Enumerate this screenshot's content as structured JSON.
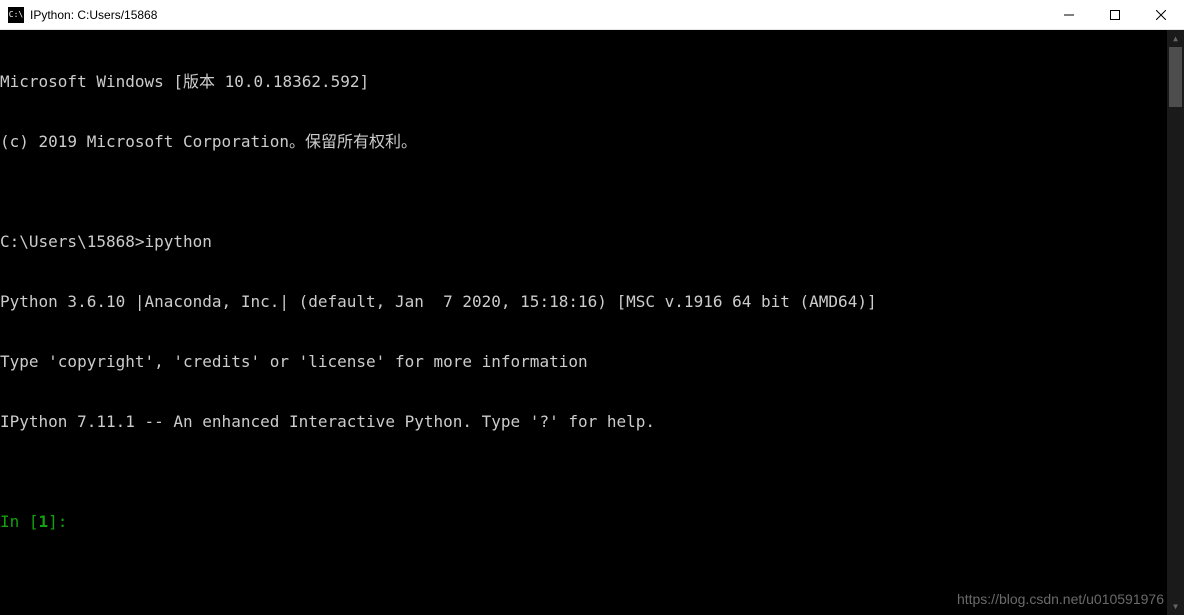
{
  "window": {
    "icon_text": "C:\\",
    "title": "IPython: C:Users/15868"
  },
  "terminal": {
    "lines": [
      "Microsoft Windows [版本 10.0.18362.592]",
      "(c) 2019 Microsoft Corporation。保留所有权利。",
      "",
      "C:\\Users\\15868>ipython",
      "Python 3.6.10 |Anaconda, Inc.| (default, Jan  7 2020, 15:18:16) [MSC v.1916 64 bit (AMD64)]",
      "Type 'copyright', 'credits' or 'license' for more information",
      "IPython 7.11.1 -- An enhanced Interactive Python. Type '?' for help.",
      ""
    ],
    "prompt": {
      "prefix": "In [",
      "number": "1",
      "suffix": "]:"
    }
  },
  "watermark": "https://blog.csdn.net/u010591976"
}
